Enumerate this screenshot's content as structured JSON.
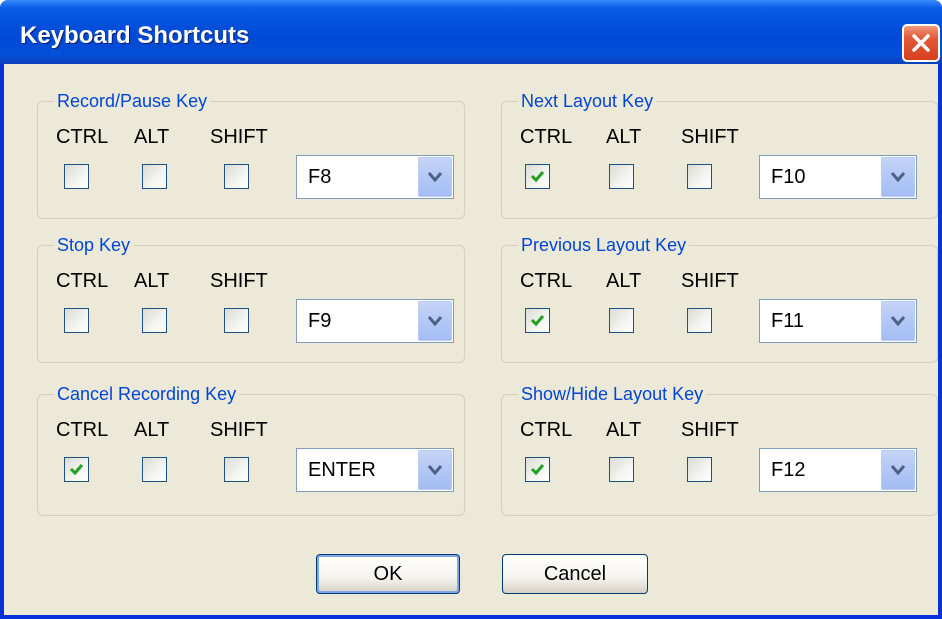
{
  "window": {
    "title": "Keyboard Shortcuts"
  },
  "modifiers": {
    "ctrl": "CTRL",
    "alt": "ALT",
    "shift": "SHIFT"
  },
  "groups": [
    {
      "label": "Record/Pause Key",
      "ctrl": false,
      "alt": false,
      "shift": false,
      "key": "F8"
    },
    {
      "label": "Stop Key",
      "ctrl": false,
      "alt": false,
      "shift": false,
      "key": "F9"
    },
    {
      "label": "Cancel Recording Key",
      "ctrl": true,
      "alt": false,
      "shift": false,
      "key": "ENTER"
    },
    {
      "label": "Next Layout Key",
      "ctrl": true,
      "alt": false,
      "shift": false,
      "key": "F10"
    },
    {
      "label": "Previous Layout Key",
      "ctrl": true,
      "alt": false,
      "shift": false,
      "key": "F11"
    },
    {
      "label": "Show/Hide Layout Key",
      "ctrl": true,
      "alt": false,
      "shift": false,
      "key": "F12"
    }
  ],
  "buttons": {
    "ok": "OK",
    "cancel": "Cancel"
  },
  "colors": {
    "title_bar": "#0453dd",
    "group_label": "#0046d5",
    "check_mark": "#21a121",
    "dialog_bg": "#ece9d8"
  }
}
